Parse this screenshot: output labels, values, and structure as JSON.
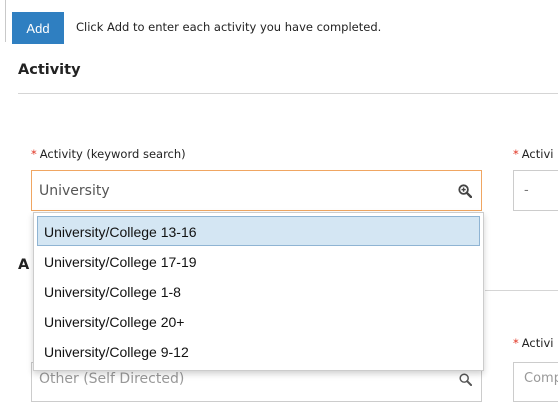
{
  "toolbar": {
    "add_label": "Add",
    "instruction": "Click Add to enter each activity you have completed."
  },
  "section": {
    "title": "Activity"
  },
  "activity_search": {
    "label": "Activity (keyword search)",
    "required_marker": "*",
    "value": "University",
    "icon": "magnifier-plus-icon"
  },
  "right_field": {
    "label": "Activi",
    "required_marker": "*",
    "value": "-"
  },
  "dropdown": {
    "options": [
      "University/College 13-16",
      "University/College 17-19",
      "University/College 1-8",
      "University/College 20+",
      "University/College 9-12"
    ],
    "highlighted_index": 0
  },
  "background": {
    "section_letter": "A",
    "right_label": "Activi",
    "right_required_marker": "*",
    "input_value": "Other (Self Directed)",
    "right_select_value": "Comp"
  },
  "colors": {
    "accent": "#2f7fc1",
    "focus_border": "#f0a662",
    "required": "#e0311f",
    "highlight": "#d4e6f3"
  }
}
